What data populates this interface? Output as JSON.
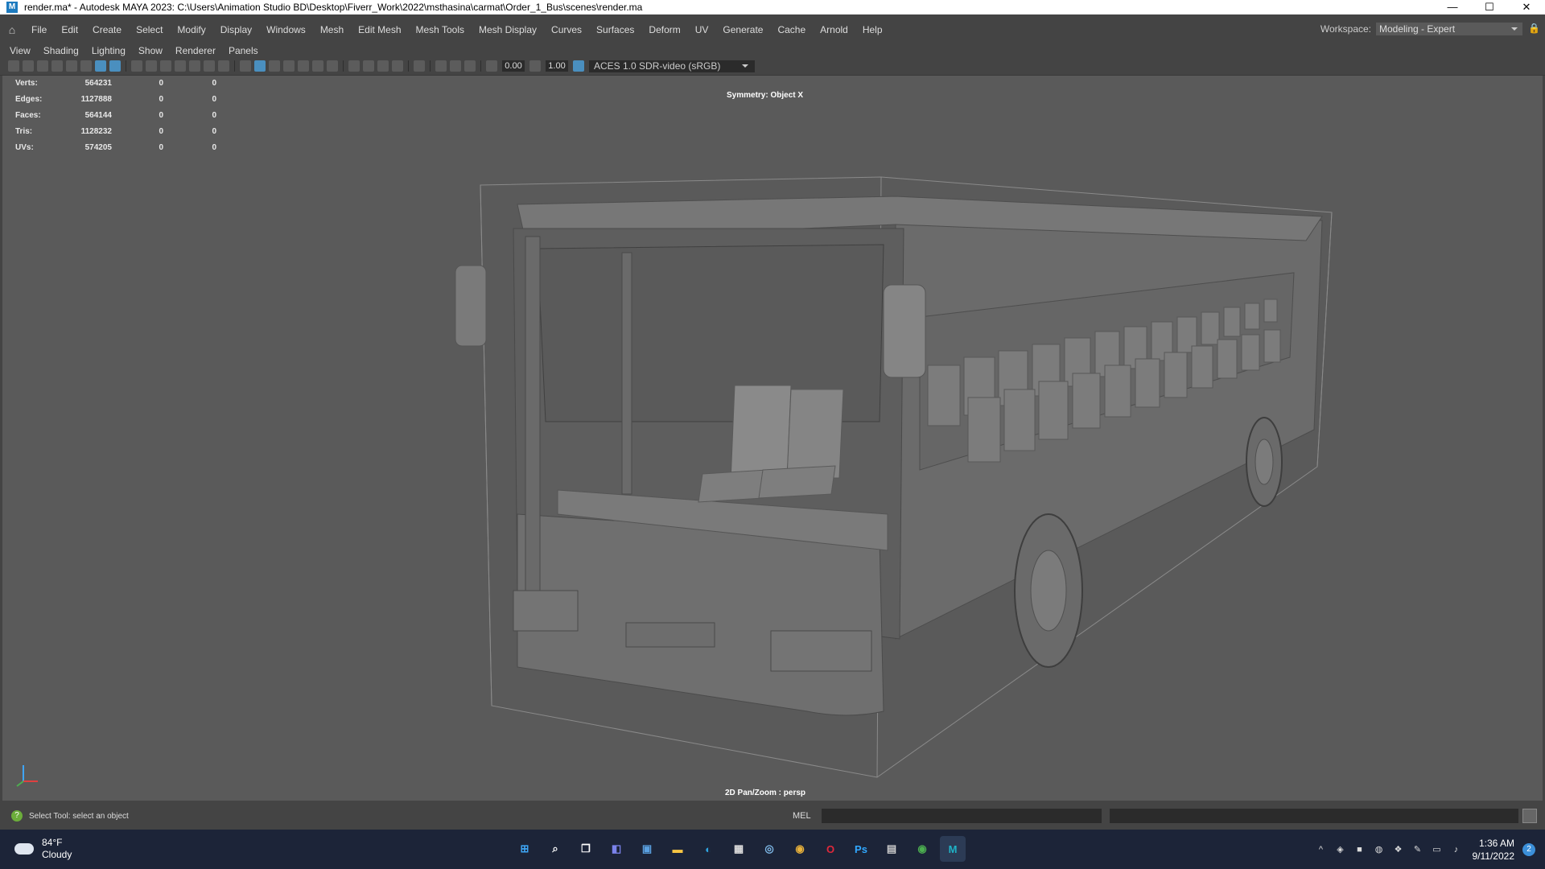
{
  "window": {
    "title": "render.ma* - Autodesk MAYA 2023: C:\\Users\\Animation Studio BD\\Desktop\\Fiverr_Work\\2022\\msthasina\\carmat\\Order_1_Bus\\scenes\\render.ma",
    "app_icon_letter": "M",
    "controls": [
      "—",
      "☐",
      "✕"
    ]
  },
  "menubar": {
    "items": [
      "File",
      "Edit",
      "Create",
      "Select",
      "Modify",
      "Display",
      "Windows",
      "Mesh",
      "Edit Mesh",
      "Mesh Tools",
      "Mesh Display",
      "Curves",
      "Surfaces",
      "Deform",
      "UV",
      "Generate",
      "Cache",
      "Arnold",
      "Help"
    ],
    "workspace_label": "Workspace:",
    "workspace_value": "Modeling - Expert"
  },
  "panel_menu": [
    "View",
    "Shading",
    "Lighting",
    "Show",
    "Renderer",
    "Panels"
  ],
  "panel_toolbar": {
    "exposure": "0.00",
    "gamma": "1.00",
    "color_space": "ACES 1.0 SDR-video (sRGB)"
  },
  "hud": {
    "rows": [
      {
        "label": "Verts:",
        "value": "564231",
        "a": "0",
        "b": "0"
      },
      {
        "label": "Edges:",
        "value": "1127888",
        "a": "0",
        "b": "0"
      },
      {
        "label": "Faces:",
        "value": "564144",
        "a": "0",
        "b": "0"
      },
      {
        "label": "Tris:",
        "value": "1128232",
        "a": "0",
        "b": "0"
      },
      {
        "label": "UVs:",
        "value": "574205",
        "a": "0",
        "b": "0"
      }
    ],
    "symmetry": "Symmetry: Object X",
    "camera": "2D Pan/Zoom : persp"
  },
  "status": {
    "help_text": "Select Tool: select an object",
    "script_label": "MEL"
  },
  "taskbar": {
    "weather_temp": "84°F",
    "weather_desc": "Cloudy",
    "apps": [
      {
        "name": "start-icon",
        "glyph": "⊞",
        "color": "#3ea6f5"
      },
      {
        "name": "search-icon",
        "glyph": "⌕",
        "color": "#ffffff"
      },
      {
        "name": "task-view-icon",
        "glyph": "❐",
        "color": "#ffffff"
      },
      {
        "name": "chat-icon",
        "glyph": "◧",
        "color": "#7b83eb"
      },
      {
        "name": "photos-icon",
        "glyph": "▣",
        "color": "#5aa0e0"
      },
      {
        "name": "file-explorer-icon",
        "glyph": "▬",
        "color": "#f6c443"
      },
      {
        "name": "edge-icon",
        "glyph": "◐",
        "color": "#2fa4e0"
      },
      {
        "name": "store-icon",
        "glyph": "▦",
        "color": "#dddddd"
      },
      {
        "name": "steam-icon",
        "glyph": "◎",
        "color": "#7fb9e8"
      },
      {
        "name": "chrome-icon",
        "glyph": "◉",
        "color": "#e9b23b"
      },
      {
        "name": "opera-icon",
        "glyph": "O",
        "color": "#e0283b"
      },
      {
        "name": "photoshop-icon",
        "glyph": "Ps",
        "color": "#31a8ff"
      },
      {
        "name": "calculator-icon",
        "glyph": "▤",
        "color": "#cccccc"
      },
      {
        "name": "chrome-profile-icon",
        "glyph": "◉",
        "color": "#4caf50"
      },
      {
        "name": "maya-icon",
        "glyph": "M",
        "color": "#1fb3c7"
      }
    ],
    "time": "1:36 AM",
    "date": "9/11/2022",
    "notification_count": "2"
  }
}
